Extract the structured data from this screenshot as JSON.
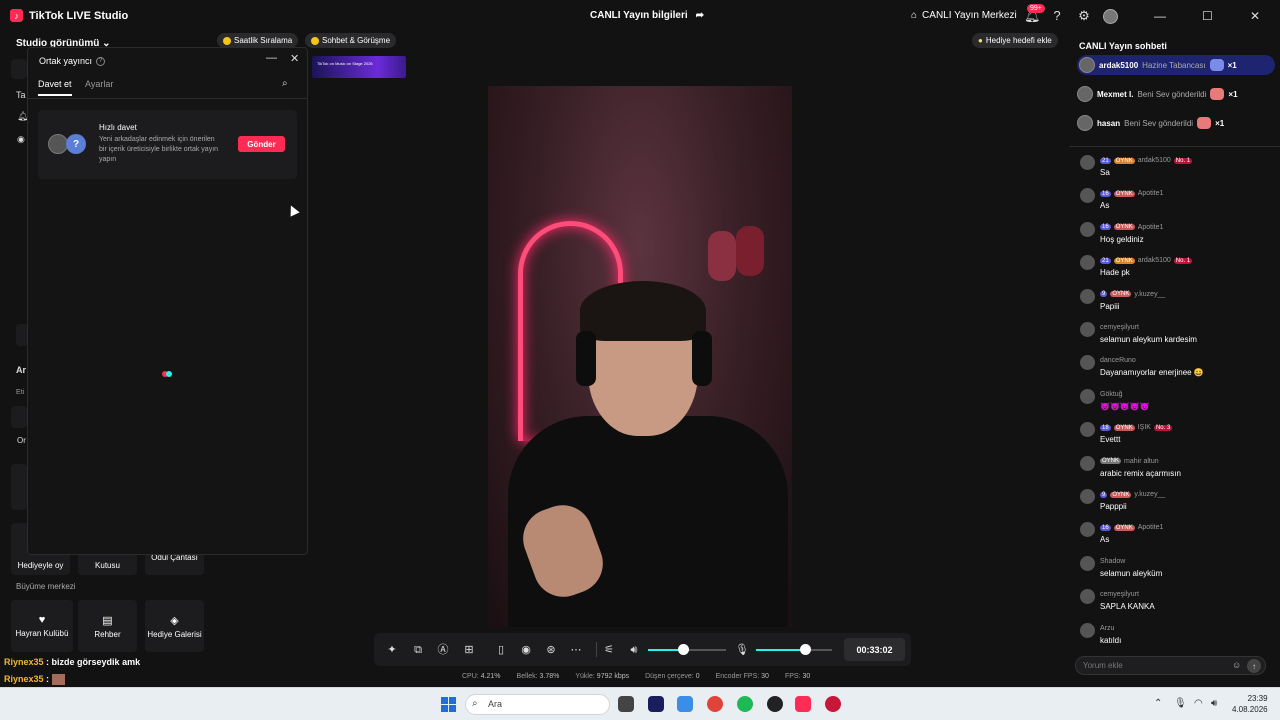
{
  "titlebar": {
    "app_title": "TikTok LIVE Studio",
    "live_info": "CANLI Yayın bilgileri",
    "live_center": "CANLI Yayın Merkezi",
    "notification_count": "99+"
  },
  "left": {
    "studio_view": "Studio görünümü",
    "peeks": [
      "Ta",
      "Ar",
      "Eti",
      "Or"
    ],
    "tile_row1": [
      "Hediyeyle oy",
      "Kutusu",
      "Ödül Çantası"
    ],
    "growth_title": "Büyüme merkezi",
    "tiles": [
      {
        "label": "Hayran Kulübü",
        "icon": "heart-icon"
      },
      {
        "label": "Rehber",
        "icon": "book-icon"
      },
      {
        "label": "Hediye Galerisi",
        "icon": "gift-gallery-icon"
      }
    ]
  },
  "top_pills": {
    "hourly_ranking": "Saatlik Sıralama",
    "chat_meet": "Sohbet & Görüşme",
    "gift_goal": "Hediye hedefi ekle"
  },
  "banner": {
    "text": "TikTok on Music on Stage 2026"
  },
  "popup": {
    "title": "Ortak yayıncı",
    "tabs": [
      "Davet et",
      "Ayarlar"
    ],
    "quick_invite_title": "Hızlı davet",
    "quick_invite_desc": "Yeni arkadaşlar edinmek için önerilen bir içerik üreticisiyle birlikte ortak yayın yapın",
    "send_label": "Gönder"
  },
  "controls": {
    "timer": "00:33:02",
    "volume_level": 0.45,
    "mic_level": 0.65
  },
  "stats": {
    "cpu_label": "CPU:",
    "cpu": "4.21%",
    "mem_label": "Bellek:",
    "mem": "3.78%",
    "upload_label": "Yükle:",
    "upload": "9792 kbps",
    "dropped_label": "Düşen çerçeve:",
    "dropped": "0",
    "encoder_label": "Encoder FPS:",
    "encoder": "30",
    "fps_label": "FPS:",
    "fps": "30"
  },
  "chat": {
    "title": "CANLI Yayın sohbeti",
    "gifts": [
      {
        "name": "ardak5100",
        "action": "Hazine Tabancası",
        "count": "×1"
      },
      {
        "name": "Mexmet I.",
        "action": "Beni Sev gönderildi",
        "count": "×1"
      },
      {
        "name": "hasan",
        "action": "Beni Sev gönderildi",
        "count": "×1"
      }
    ],
    "messages": [
      {
        "level": "21",
        "tag": "OYNK",
        "user": "ardak5100",
        "rank": "No. 1",
        "text": "Sa"
      },
      {
        "level": "16",
        "tag": "OYNK",
        "user": "Apotite1",
        "rank": "",
        "text": "As"
      },
      {
        "level": "16",
        "tag": "OYNK",
        "user": "Apotite1",
        "rank": "",
        "text": "Hoş geldiniz"
      },
      {
        "level": "21",
        "tag": "OYNK",
        "user": "ardak5100",
        "rank": "No. 1",
        "text": "Hade pk"
      },
      {
        "level": "9",
        "tag": "OYNK",
        "user": "y.kuzey__",
        "rank": "",
        "text": "Papiii"
      },
      {
        "level": "",
        "tag": "",
        "user": "cemyeşilyurt",
        "rank": "",
        "text": "selamun aleykum kardesim"
      },
      {
        "level": "",
        "tag": "",
        "user": "danceRuno",
        "rank": "",
        "text": "Dayanamıyorlar enerjinee 😄"
      },
      {
        "level": "",
        "tag": "",
        "user": "Göktuğ",
        "rank": "",
        "text": "😈😈😈😈😈"
      },
      {
        "level": "18",
        "tag": "OYNK",
        "user": "IŞIK",
        "rank": "No. 3",
        "text": "Evettt"
      },
      {
        "level": "",
        "tag": "OYNK",
        "user": "mahir altun",
        "rank": "",
        "text": "arabic remix açarmısın"
      },
      {
        "level": "9",
        "tag": "OYNK",
        "user": "y.kuzey__",
        "rank": "",
        "text": "Papppii"
      },
      {
        "level": "16",
        "tag": "OYNK",
        "user": "Apotite1",
        "rank": "",
        "text": "As"
      },
      {
        "level": "",
        "tag": "",
        "user": "Shadow",
        "rank": "",
        "text": "selamun aleyküm"
      },
      {
        "level": "",
        "tag": "",
        "user": "cemyeşilyurt",
        "rank": "",
        "text": "SAPLA KANKA"
      },
      {
        "level": "",
        "tag": "",
        "user": "Arzu",
        "rank": "",
        "text": "katıldı"
      }
    ],
    "input_placeholder": "Yorum ekle"
  },
  "overlay_chat": [
    {
      "name": "Riynex35",
      "text": ": bizde görseydik amk"
    },
    {
      "name": "Riynex35",
      "text": ":"
    }
  ],
  "taskbar": {
    "search_placeholder": "Ara",
    "time": "23:39",
    "date": "4.08.2026"
  },
  "colors": {
    "accent": "#fe2c55",
    "cyan": "#25f4ee",
    "background": "#121212"
  }
}
